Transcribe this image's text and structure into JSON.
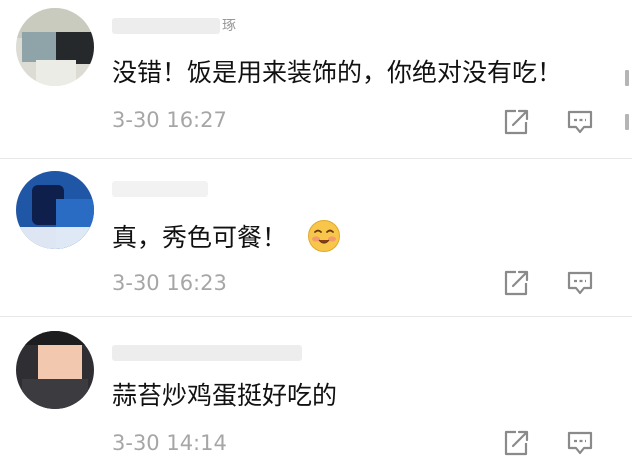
{
  "comments": [
    {
      "text": "没错！饭是用来装饰的，你绝对没有吃！",
      "time": "3-30 16:27",
      "username_partial": "琢",
      "icons": {
        "share": "share-icon",
        "reply": "reply-icon"
      }
    },
    {
      "text": "真，秀色可餐！",
      "emoji": "blush-emoji",
      "time": "3-30 16:23",
      "username_partial": "",
      "icons": {
        "share": "share-icon",
        "reply": "reply-icon"
      }
    },
    {
      "text": "蒜苔炒鸡蛋挺好吃的",
      "time": "3-30 14:14",
      "username_partial": "",
      "icons": {
        "share": "share-icon",
        "reply": "reply-icon"
      }
    }
  ],
  "colors": {
    "text": "#111111",
    "meta": "#a6a6a6",
    "icon": "#8a8a8a",
    "divider": "#e8e8e8"
  }
}
